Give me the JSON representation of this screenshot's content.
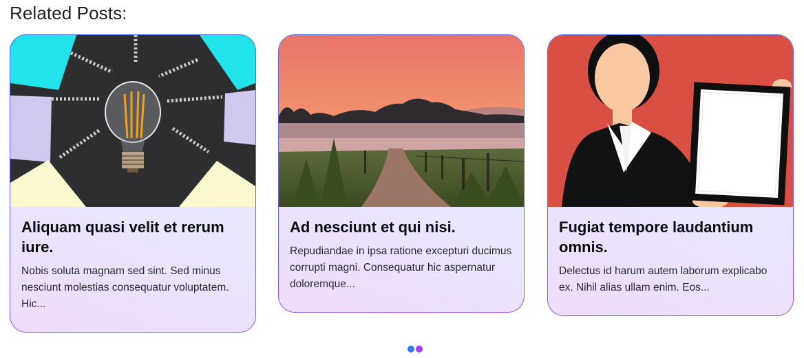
{
  "section": {
    "title": "Related Posts:"
  },
  "posts": [
    {
      "title": "Aliquam quasi velit et rerum iure.",
      "excerpt": "Nobis soluta magnam sed sint. Sed minus nesciunt molestias consequatur voluptatem. Hic...",
      "image": "lightbulb-image"
    },
    {
      "title": "Ad nesciunt et qui nisi.",
      "excerpt": "Repudiandae in ipsa ratione excepturi ducimus corrupti magni. Consequatur hic aspernatur doloremque...",
      "image": "misty-path-sunset-image"
    },
    {
      "title": "Fugiat tempore laudantium omnis.",
      "excerpt": "Delectus id harum autem laborum explicabo ex. Nihil alias ullam enim. Eos...",
      "image": "businesswoman-frame-image"
    }
  ],
  "pagination": {
    "dots": [
      {
        "color": "#2f7cf6",
        "active": true
      },
      {
        "color": "#a23ef0",
        "active": false
      }
    ]
  },
  "colors": {
    "card_border_start": "#4b6df0",
    "card_border_end": "#a74df0",
    "card_bg": "#eae7fb"
  }
}
